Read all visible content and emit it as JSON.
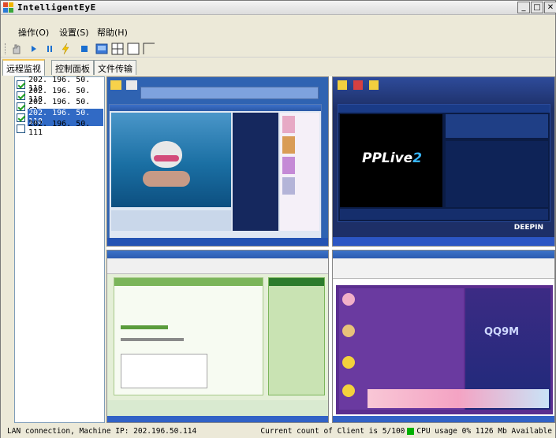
{
  "window": {
    "title": "IntelligentEyE"
  },
  "menu": [
    "操作(O)",
    "设置(S)",
    "帮助(H)"
  ],
  "tabs": [
    "远程监视",
    "控制面板",
    "文件传输"
  ],
  "clients": [
    {
      "ip": "202. 196. 50. 118",
      "checked": true,
      "selected": false
    },
    {
      "ip": "202. 196. 50. 118",
      "checked": true,
      "selected": false
    },
    {
      "ip": "202. 196. 50. 63",
      "checked": true,
      "selected": false
    },
    {
      "ip": "202. 196. 50. 118",
      "checked": true,
      "selected": true
    },
    {
      "ip": "202. 196. 50. 111",
      "checked": false,
      "selected": false
    }
  ],
  "screens": {
    "s2_logo": "PPLive",
    "s2_logo_num": "2",
    "s2_brand": "DEEPIN",
    "s4_logo": "QQ9M"
  },
  "status": {
    "left": "LAN connection,  Machine IP: 202.196.50.114",
    "clients": "Current count of Client is 5/100",
    "cpu": "CPU usage 0% 1126 Mb Available"
  }
}
